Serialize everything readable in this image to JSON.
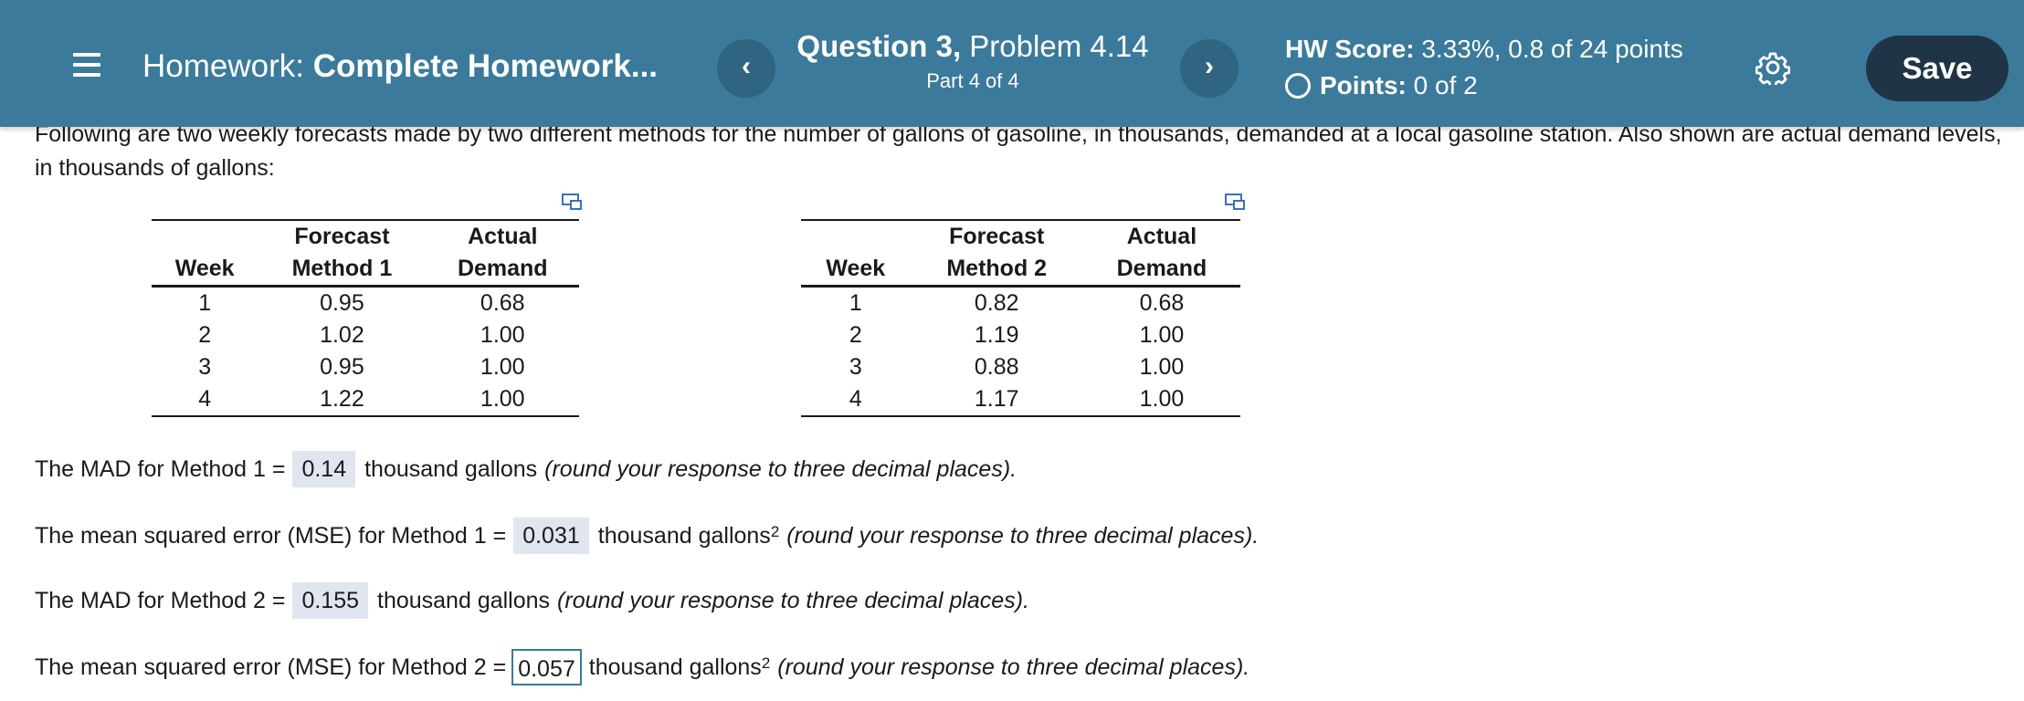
{
  "header": {
    "title_prefix": "Homework:",
    "title_name": "Complete Homework...",
    "prev_label": "‹",
    "next_label": "›",
    "question_label": "Question 3,",
    "problem_label": "Problem 4.14",
    "part_label": "Part 4 of 4",
    "hw_score_label": "HW Score:",
    "hw_score_value": "3.33%, 0.8 of 24 points",
    "points_label": "Points:",
    "points_value": "0 of 2",
    "save_label": "Save",
    "colors": {
      "header_bg": "#3b7a9a",
      "save_bg": "#1f3446",
      "nav_bg": "#2f6580"
    }
  },
  "intro": "Following are two weekly forecasts made by two different methods for the number of gallons of gasoline, in thousands, demanded at a local gasoline station. Also shown are actual demand levels, in thousands of gallons:",
  "table1": {
    "headers": [
      [
        "",
        "Forecast",
        "Actual"
      ],
      [
        "Week",
        "Method 1",
        "Demand"
      ]
    ],
    "rows": [
      [
        "1",
        "0.95",
        "0.68"
      ],
      [
        "2",
        "1.02",
        "1.00"
      ],
      [
        "3",
        "0.95",
        "1.00"
      ],
      [
        "4",
        "1.22",
        "1.00"
      ]
    ]
  },
  "table2": {
    "headers": [
      [
        "",
        "Forecast",
        "Actual"
      ],
      [
        "Week",
        "Method 2",
        "Demand"
      ]
    ],
    "rows": [
      [
        "1",
        "0.82",
        "0.68"
      ],
      [
        "2",
        "1.19",
        "1.00"
      ],
      [
        "3",
        "0.88",
        "1.00"
      ],
      [
        "4",
        "1.17",
        "1.00"
      ]
    ]
  },
  "questions": [
    {
      "prefix": "The MAD for Method 1 =",
      "answer": "0.14",
      "unit": "thousand gallons",
      "sup": "",
      "note": "(round your response to three decimal places)."
    },
    {
      "prefix": "The mean squared error (MSE) for Method 1 =",
      "answer": "0.031",
      "unit": "thousand gallons",
      "sup": "2",
      "note": "(round your response to three decimal places)."
    },
    {
      "prefix": "The MAD for Method 2 =",
      "answer": "0.155",
      "unit": "thousand gallons",
      "sup": "",
      "note": "(round your response to three decimal places)."
    },
    {
      "prefix": "The mean squared error (MSE) for Method 2 =",
      "answer": "0.057",
      "unit": "thousand gallons",
      "sup": "2",
      "note": "(round your response to three decimal places)."
    }
  ]
}
